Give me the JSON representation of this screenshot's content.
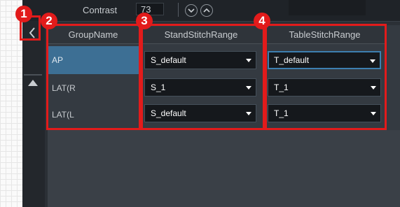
{
  "toolbar": {
    "contrast_label": "Contrast",
    "contrast_value": "73",
    "zoom_down_icon": "chevron-down-icon",
    "zoom_up_icon": "chevron-up-icon"
  },
  "left_rail": {
    "collapse_icon": "chevron-left-icon",
    "scroll_icon": "triangle-up-icon"
  },
  "table": {
    "headers": {
      "group_name": "GroupName",
      "stand": "StandStitchRange",
      "table": "TableStitchRange"
    },
    "rows": [
      {
        "name": "AP",
        "stand": "S_default",
        "table": "T_default",
        "selected": true
      },
      {
        "name": "LAT(R",
        "stand": "S_1",
        "table": "T_1",
        "selected": false
      },
      {
        "name": "LAT(L",
        "stand": "S_default",
        "table": "T_1",
        "selected": false
      }
    ]
  },
  "annotations": {
    "color": "#e21b1b",
    "badges": [
      "1",
      "2",
      "3",
      "4"
    ]
  }
}
